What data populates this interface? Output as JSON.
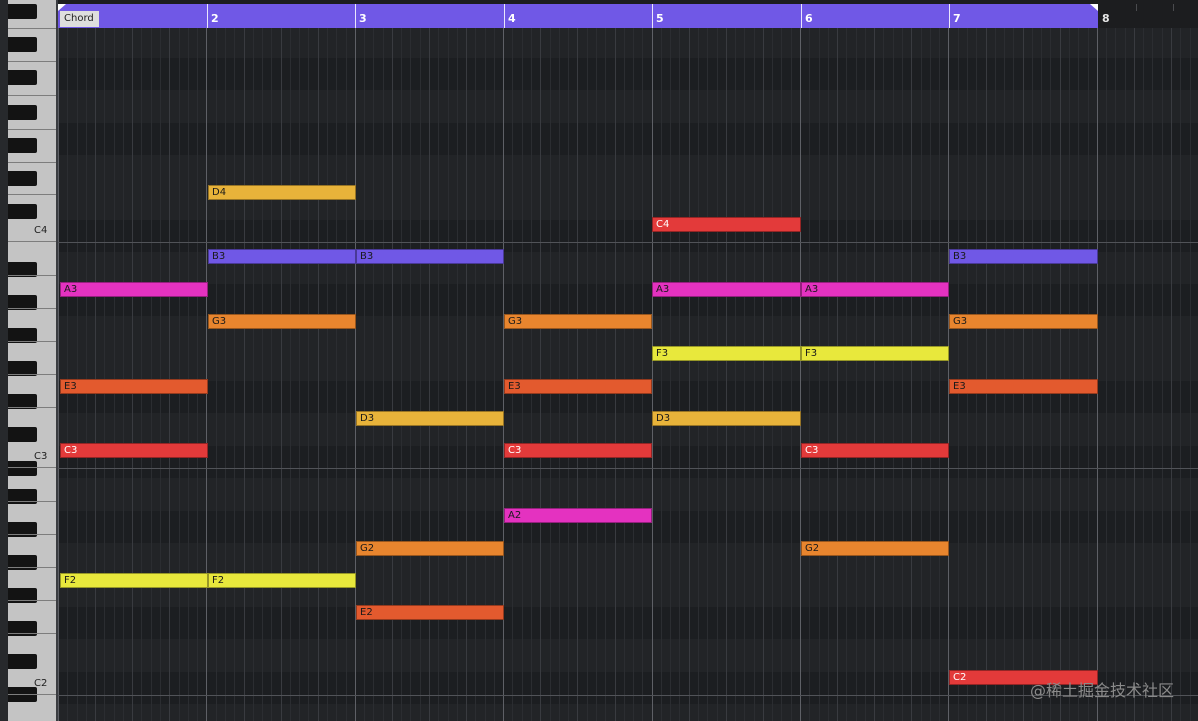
{
  "ruler": {
    "bars": [
      "2",
      "3",
      "4",
      "5",
      "6",
      "7",
      "8"
    ],
    "chord_label": "Chord",
    "bar_color": "#7058e6"
  },
  "keyboard": {
    "octave_labels": [
      "C4",
      "C3",
      "C2"
    ]
  },
  "notes": [
    {
      "label": "D4",
      "color": "#e8b33a",
      "light": false
    },
    {
      "label": "C4",
      "color": "#e33a3a",
      "light": true
    },
    {
      "label": "B3",
      "color": "#7058e6",
      "light": false
    },
    {
      "label": "B3",
      "color": "#7058e6",
      "light": false
    },
    {
      "label": "B3",
      "color": "#7058e6",
      "light": false
    },
    {
      "label": "A3",
      "color": "#e432c0",
      "light": false
    },
    {
      "label": "A3",
      "color": "#e432c0",
      "light": false
    },
    {
      "label": "A3",
      "color": "#e432c0",
      "light": false
    },
    {
      "label": "G3",
      "color": "#e8852e",
      "light": false
    },
    {
      "label": "G3",
      "color": "#e8852e",
      "light": false
    },
    {
      "label": "G3",
      "color": "#e8852e",
      "light": false
    },
    {
      "label": "F3",
      "color": "#e8e83c",
      "light": false
    },
    {
      "label": "F3",
      "color": "#e8e83c",
      "light": false
    },
    {
      "label": "E3",
      "color": "#e35a2e",
      "light": false
    },
    {
      "label": "E3",
      "color": "#e35a2e",
      "light": false
    },
    {
      "label": "E3",
      "color": "#e35a2e",
      "light": false
    },
    {
      "label": "D3",
      "color": "#e8b33a",
      "light": false
    },
    {
      "label": "D3",
      "color": "#e8b33a",
      "light": false
    },
    {
      "label": "C3",
      "color": "#e33a3a",
      "light": true
    },
    {
      "label": "C3",
      "color": "#e33a3a",
      "light": true
    },
    {
      "label": "C3",
      "color": "#e33a3a",
      "light": true
    },
    {
      "label": "A2",
      "color": "#e432c0",
      "light": false
    },
    {
      "label": "G2",
      "color": "#e8852e",
      "light": false
    },
    {
      "label": "G2",
      "color": "#e8852e",
      "light": false
    },
    {
      "label": "F2",
      "color": "#e8e83c",
      "light": false
    },
    {
      "label": "F2",
      "color": "#e8e83c",
      "light": false
    },
    {
      "label": "E2",
      "color": "#e35a2e",
      "light": false
    },
    {
      "label": "C2",
      "color": "#e33a3a",
      "light": true
    }
  ],
  "watermark": "@稀土掘金技术社区"
}
